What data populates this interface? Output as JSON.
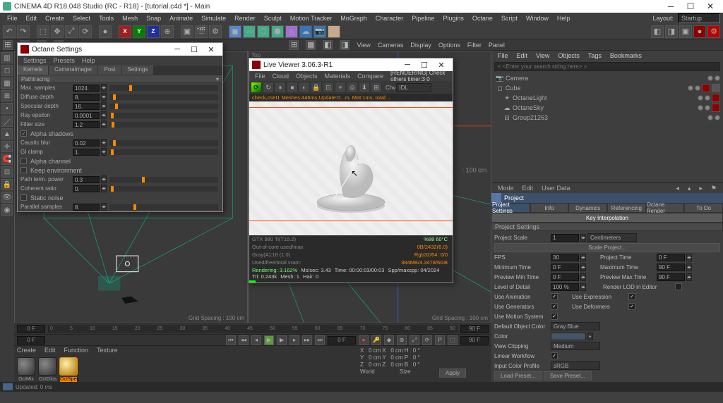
{
  "app": {
    "title": "CINEMA 4D R18.048 Studio (RC - R18) - [tutorial.c4d *] - Main",
    "layout_label": "Layout:",
    "layout_value": "Startup"
  },
  "menu": [
    "File",
    "Edit",
    "Create",
    "Select",
    "Tools",
    "Mesh",
    "Snap",
    "Animate",
    "Simulate",
    "Render",
    "Sculpt",
    "Motion Tracker",
    "MoGraph",
    "Character",
    "Pipeline",
    "Plugins",
    "Octane",
    "Script",
    "Window",
    "Help"
  ],
  "sub_menu_vp": [
    "View",
    "Cameras",
    "Display",
    "Options",
    "Filter",
    "Panel"
  ],
  "viewport": {
    "top_label": "Top",
    "grid_spacing": "Grid Spacing : 100 cm"
  },
  "timeline": {
    "start": "0 F",
    "end": "90 F",
    "cur": "0 F",
    "ticks": [
      "0",
      "5",
      "10",
      "15",
      "20",
      "25",
      "30",
      "35",
      "40",
      "45",
      "50",
      "55",
      "60",
      "65",
      "70",
      "75",
      "80",
      "85",
      "90"
    ]
  },
  "objects": {
    "menu": [
      "File",
      "Edit",
      "View",
      "Objects",
      "Tags",
      "Bookmarks"
    ],
    "search_placeholder": "< <Enter your search string here> >",
    "items": [
      {
        "name": "Camera",
        "indent": 0
      },
      {
        "name": "Cube",
        "indent": 0
      },
      {
        "name": "OctaneLight",
        "indent": 1
      },
      {
        "name": "OctaneSky",
        "indent": 1
      },
      {
        "name": "Group21263",
        "indent": 1
      }
    ]
  },
  "attr": {
    "menu": [
      "Mode",
      "Edit",
      "User Data"
    ],
    "title": "Project",
    "tabs": [
      "Project Settings",
      "Info",
      "Dynamics",
      "Referencing",
      "Octane Render",
      "To Do"
    ],
    "subtab": "Key Interpolation",
    "section": "Project Settings",
    "scale_label": "Project Scale",
    "scale_val": "1",
    "scale_unit": "Centimeters",
    "scale_btn": "Scale Project...",
    "rows": [
      {
        "l": "FPS",
        "v": "30",
        "l2": "Project Time",
        "v2": "0 F"
      },
      {
        "l": "Minimum Time",
        "v": "0 F",
        "l2": "Maximum Time",
        "v2": "90 F"
      },
      {
        "l": "Preview Min Time",
        "v": "0 F",
        "l2": "Preview Max Time",
        "v2": "90 F"
      }
    ],
    "lod_label": "Level of Detail",
    "lod_val": "100 %",
    "lod_r": "Render LOD in Editor",
    "checks": [
      {
        "l": "Use Animation",
        "c": true,
        "l2": "Use Expression",
        "c2": true
      },
      {
        "l": "Use Generators",
        "c": true,
        "l2": "Use Deformers",
        "c2": true
      },
      {
        "l": "Use Motion System",
        "c": true,
        "l2": "",
        "c2": null
      }
    ],
    "doc_label": "Default Object Color",
    "doc_val": "Gray Blue",
    "color_label": "Color",
    "vc_label": "View Clipping",
    "vc_val": "Medium",
    "lw_label": "Linear Workflow",
    "lw_checked": true,
    "icp_label": "Input Color Profile",
    "icp_val": "sRGB",
    "load_btn": "Load Preset...",
    "save_btn": "Save Preset..."
  },
  "materials": {
    "menu": [
      "Create",
      "Edit",
      "Function",
      "Texture"
    ],
    "items": [
      "OctMix",
      "OctGlos",
      "OctSpec"
    ]
  },
  "coords": {
    "labels": [
      "X",
      "Y",
      "Z"
    ],
    "pos": [
      "0 cm",
      "0 cm",
      "0 cm"
    ],
    "size": [
      "0 cm",
      "0 cm",
      "0 cm"
    ],
    "rot": [
      "0 °",
      "0 °",
      "0 °"
    ],
    "hpb": [
      "H",
      "P",
      "B"
    ],
    "world": "World",
    "size_lbl": "Size",
    "apply": "Apply"
  },
  "status": "Updated: 0 ms",
  "octane_settings": {
    "title": "Octane Settings",
    "menu": [
      "Settings",
      "Presets",
      "Help"
    ],
    "tabs": [
      "Kernels",
      "CameraImager",
      "Post",
      "Settings"
    ],
    "section": "Pathtracing",
    "rows": [
      {
        "l": "Max. samples",
        "v": "1024.",
        "p": 18
      },
      {
        "l": "Diffuse depth",
        "v": "8.",
        "p": 3
      },
      {
        "l": "Specular depth",
        "v": "16.",
        "p": 5
      },
      {
        "l": "Ray epsilon",
        "v": "0.0001",
        "p": 1
      },
      {
        "l": "Filter size",
        "v": "1.2",
        "p": 2
      }
    ],
    "checks1": [
      {
        "l": "Alpha shadows",
        "c": true
      }
    ],
    "rows2": [
      {
        "l": "Caustic blur",
        "v": "0.02",
        "p": 3
      },
      {
        "l": "GI clamp",
        "v": "1.",
        "p": 1
      }
    ],
    "checks2": [
      {
        "l": "Alpha channel",
        "c": false
      },
      {
        "l": "Keep environment",
        "c": false
      }
    ],
    "rows3": [
      {
        "l": "Path term. power",
        "v": "0.3",
        "p": 30
      },
      {
        "l": "Coherent ratio",
        "v": "0.",
        "p": 1
      }
    ],
    "checks3": [
      {
        "l": "Static noise",
        "c": false
      }
    ],
    "rows4": [
      {
        "l": "Parallel samples",
        "v": "8.",
        "p": 22
      }
    ]
  },
  "live_viewer": {
    "title": "Live Viewer 3.06.3-R1",
    "menu": [
      "File",
      "Cloud",
      "Objects",
      "Materials",
      "Compare"
    ],
    "render_label": "[RENDERING] Check others timer:3  0",
    "chv_label": "Chv",
    "chv_val": "IDL",
    "info_top": "check,cset1  Meshes:446ms,Update:0...m,  Mat:1ms, total:...",
    "stats": [
      {
        "l": "GTX 980 Ti(T15.2)",
        "r": "%88    60°C"
      },
      {
        "l": "Out-of-core used/max",
        "r": "0B/2432(6.0)"
      },
      {
        "l": "Gray(A):16 (1.0)",
        "r": "Rgb32/64: 0/0"
      },
      {
        "l": "Used/free/total vram:",
        "r": "384MB/4.3478/6GB"
      }
    ],
    "render_line": {
      "rendering": "Rendering: 3.162%",
      "ms": "Ms/sec: 3.43",
      "time": "Time: 00:00:03/00:03",
      "spp": "Spp/maxspp: 04/2024",
      "tri": "Tri: 0.243k",
      "mesh": "Mesh: 1",
      "hair": "Hair: 0"
    }
  }
}
